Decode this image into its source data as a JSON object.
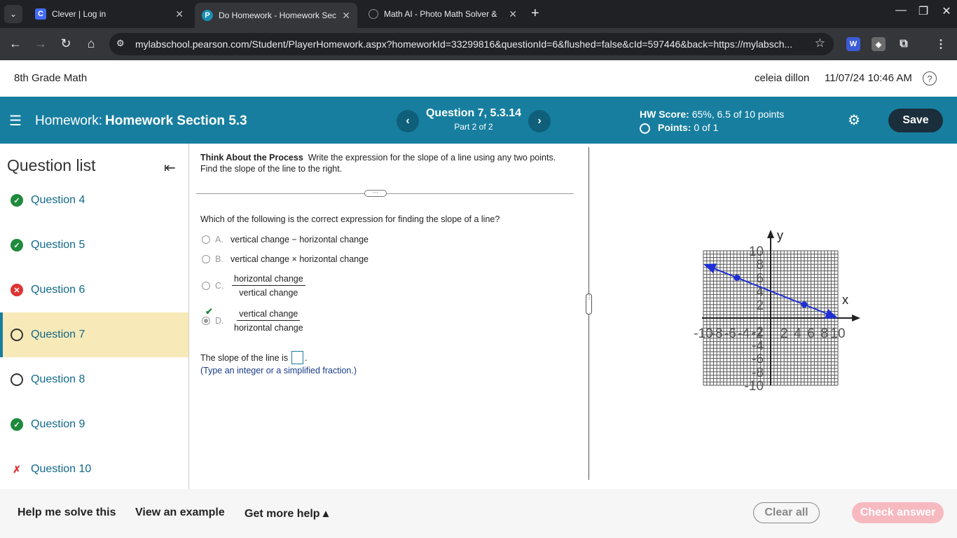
{
  "browser": {
    "tabs": [
      {
        "title": "Clever | Log in",
        "favicon": "C",
        "color": "#436cf5"
      },
      {
        "title": "Do Homework - Homework Sec",
        "favicon": "P",
        "color": "#1a8fb4"
      },
      {
        "title": "Math AI - Photo Math Solver &",
        "favicon": "globe",
        "color": "#8f8f8f"
      }
    ],
    "url": "mylabschool.pearson.com/Student/PlayerHomework.aspx?homeworkId=33299816&questionId=6&flushed=false&cId=597446&back=https://mylabsch..."
  },
  "header": {
    "course": "8th Grade Math",
    "user": "celeia dillon",
    "datetime": "11/07/24 10:46 AM",
    "help": "?"
  },
  "hwbar": {
    "prefix": "Homework:",
    "title": "Homework Section 5.3",
    "question_title": "Question 7, 5.3.14",
    "part": "Part 2 of 2",
    "hw_score_label": "HW Score:",
    "hw_score_value": "65%, 6.5 of 10 points",
    "points_label": "Points:",
    "points_value": "0 of 1",
    "save": "Save"
  },
  "question_list": {
    "heading": "Question list",
    "items": [
      {
        "label": "Question 4",
        "status": "done"
      },
      {
        "label": "Question 5",
        "status": "done"
      },
      {
        "label": "Question 6",
        "status": "wrong"
      },
      {
        "label": "Question 7",
        "status": "current"
      },
      {
        "label": "Question 8",
        "status": "empty"
      },
      {
        "label": "Question 9",
        "status": "done"
      },
      {
        "label": "Question 10",
        "status": "partial"
      }
    ]
  },
  "question": {
    "prompt_bold": "Think About the Process",
    "prompt_text": "Write the expression for the slope of a line using any two points. Find the slope of the line to the right.",
    "ask": "Which of the following is the correct expression for finding the slope of a line?",
    "choices": {
      "a": {
        "letter": "A.",
        "text": "vertical change − horizontal change"
      },
      "b": {
        "letter": "B.",
        "text": "vertical change × horizontal change"
      },
      "c": {
        "letter": "C.",
        "num": "horizontal change",
        "den": "vertical change"
      },
      "d": {
        "letter": "D.",
        "num": "vertical change",
        "den": "horizontal change"
      }
    },
    "selected": "D",
    "slope_text": "The slope of the line is",
    "slope_end": ".",
    "hint": "(Type an integer or a simplified fraction.)"
  },
  "graph": {
    "x_label": "x",
    "y_label": "y",
    "x_ticks": [
      "-10",
      "-8",
      "-6",
      "-4",
      "-2",
      "2",
      "4",
      "6",
      "8",
      "10"
    ],
    "y_ticks": [
      "10",
      "8",
      "6",
      "4",
      "2",
      "-2",
      "-4",
      "-6",
      "-8",
      "-10"
    ],
    "range": [
      -10,
      10
    ],
    "line_color": "#1f2fd6",
    "line_endpoints": [
      [
        -10,
        8
      ],
      [
        10,
        0
      ]
    ],
    "points": [
      [
        -5,
        6
      ],
      [
        5,
        2
      ]
    ]
  },
  "bottom": {
    "help_solve": "Help me solve this",
    "example": "View an example",
    "more_help": "Get more help ▴",
    "clear": "Clear all",
    "check": "Check answer"
  }
}
